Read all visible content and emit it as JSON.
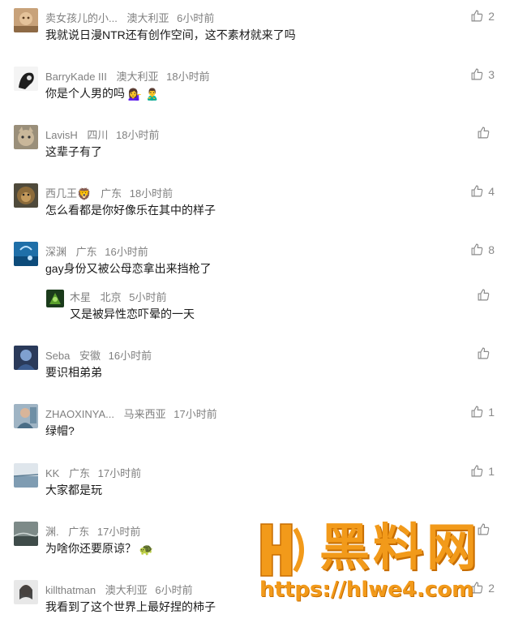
{
  "comments": [
    {
      "name": "卖女孩儿的小...",
      "region": "澳大利亚",
      "time": "6小时前",
      "text": "我就说日漫NTR还有创作空间，这不素材就来了吗",
      "likes": "2"
    },
    {
      "name": "BarryKade III",
      "region": "澳大利亚",
      "time": "18小时前",
      "text": "你是个人男的吗",
      "text_emoji": "💁‍♀️ 🙎‍♂️",
      "likes": "3"
    },
    {
      "name": "LavisH",
      "region": "四川",
      "time": "18小时前",
      "text": "这辈子有了",
      "likes": ""
    },
    {
      "name": "西几王",
      "name_emoji": "🦁",
      "region": "广东",
      "time": "18小时前",
      "text": "怎么看都是你好像乐在其中的样子",
      "likes": "4"
    },
    {
      "name": "深渊",
      "region": "广东",
      "time": "16小时前",
      "text": "gay身份又被公母恋拿出来挡枪了",
      "likes": "8"
    },
    {
      "name": "木星",
      "region": "北京",
      "time": "5小时前",
      "text": "又是被异性恋吓晕的一天",
      "likes": ""
    },
    {
      "name": "Seba",
      "region": "安徽",
      "time": "16小时前",
      "text": "要识相弟弟",
      "likes": ""
    },
    {
      "name": "ZHAOXINYA...",
      "region": "马来西亚",
      "time": "17小时前",
      "text": "绿帽?",
      "likes": "1"
    },
    {
      "name": "KK",
      "region": "广东",
      "time": "17小时前",
      "text": "大家都是玩",
      "likes": "1"
    },
    {
      "name": "渊.",
      "region": "广东",
      "time": "17小时前",
      "text": "为啥你还要原谅？",
      "text_emoji": "🐢",
      "likes": ""
    },
    {
      "name": "killthatman",
      "region": "澳大利亚",
      "time": "6小时前",
      "text": "我看到了这个世界上最好捏的柿子",
      "likes": "2"
    }
  ],
  "watermark": {
    "brand": "黑料网",
    "url": "https://hlwe4.com"
  },
  "colors": {
    "meta": "#808080",
    "text": "#1a1a1a",
    "watermark": "#f29a1a"
  }
}
